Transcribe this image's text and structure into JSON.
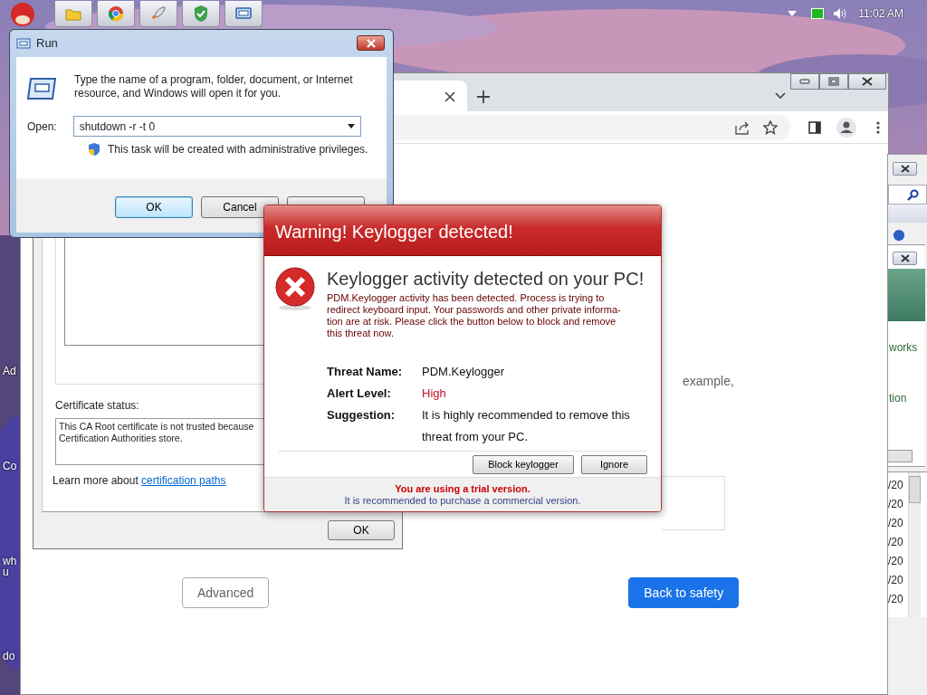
{
  "taskbar": {
    "clock": "11:02 AM"
  },
  "desktop_icons": [
    {
      "label": "Ad"
    },
    {
      "label": "Co"
    },
    {
      "label": "wh\nu"
    },
    {
      "label": "do"
    }
  ],
  "browser": {
    "page": {
      "partial_text": "example,",
      "buttons": [
        {
          "label": "Advanced",
          "kind": "secondary"
        },
        {
          "label": "Back to safety",
          "kind": "primary"
        }
      ]
    }
  },
  "certificate_dialog": {
    "status_label": "Certificate status:",
    "status_text": "This CA Root certificate is not trusted because\nCertification Authorities store.",
    "learn_more": "Learn more about",
    "link": "certification paths",
    "ok": "OK"
  },
  "run_dialog": {
    "title": "Run",
    "description": "Type the name of a program, folder, document, or Internet\nresource, and Windows will open it for you.",
    "open_label": "Open:",
    "command": "shutdown -r -t 0",
    "note": "This task will be created with administrative privileges.",
    "buttons": [
      {
        "label": "OK",
        "default": true
      },
      {
        "label": "Cancel",
        "default": false
      }
    ]
  },
  "warning": {
    "title": "Warning! Keylogger detected!",
    "heading": "Keylogger activity detected on your PC!",
    "message": "PDM.Keylogger activity has been detected. Process is trying to\nredirect keyboard input. Your passwords and other private informa-\ntion are at risk. Please click the button below to block and remove\nthis threat now.",
    "details": [
      {
        "label": "Threat Name:",
        "value": "PDM.Keylogger",
        "kind": "normal"
      },
      {
        "label": "Alert Level:",
        "value": "High",
        "kind": "alert"
      },
      {
        "label": "Suggestion:",
        "value": "It is highly recommended to remove this threat from your PC.",
        "kind": "normal"
      }
    ],
    "buttons": [
      "Block keylogger",
      "Ignore"
    ],
    "trial_notice": "You are using a trial version.",
    "recommendation": "It is recommended to purchase a commercial version."
  },
  "side_windows": {
    "texts": [
      "works",
      "tion"
    ],
    "dates": [
      "/20",
      "/20",
      "/20",
      "/20",
      "/20",
      "/20",
      "/20"
    ]
  }
}
